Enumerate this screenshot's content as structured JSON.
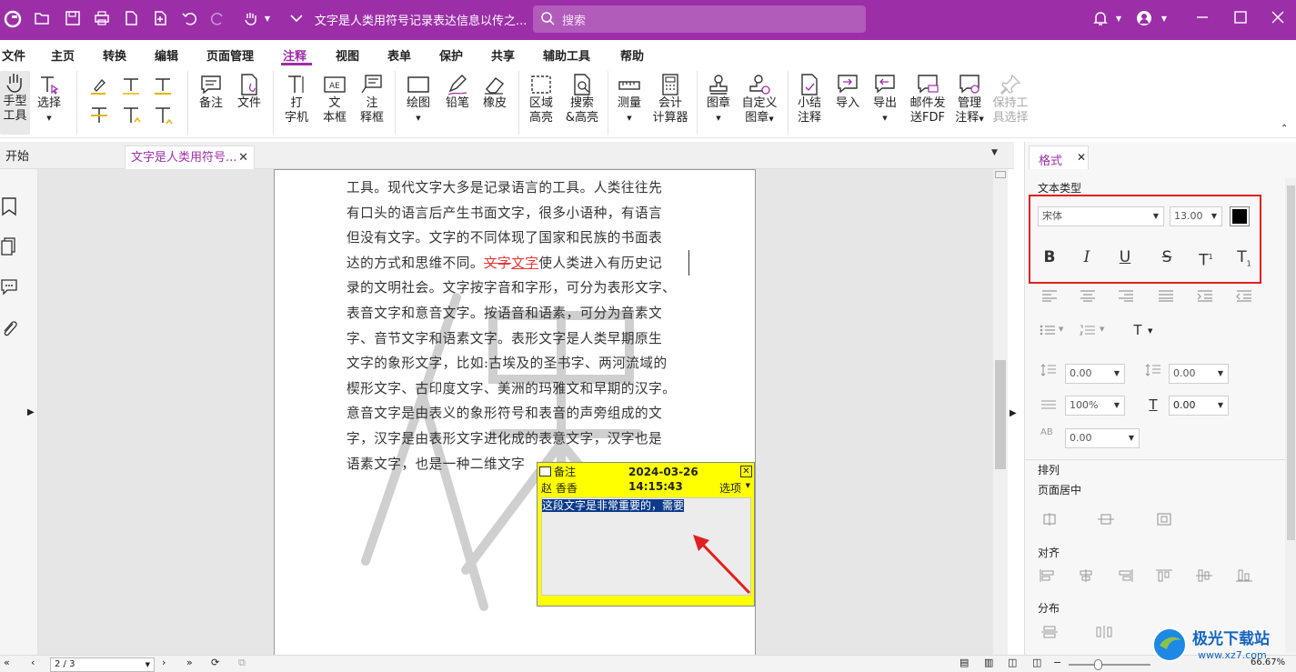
{
  "titlebar": {
    "doc_title": "文字是人类用符号记录表达信息以传之...",
    "search_placeholder": "搜索",
    "bg": "#9c2fa8"
  },
  "menu": [
    "文件",
    "主页",
    "转换",
    "编辑",
    "页面管理",
    "注释",
    "视图",
    "表单",
    "保护",
    "共享",
    "辅助工具",
    "帮助"
  ],
  "menu_active": "注释",
  "ribbon": {
    "hand_tool": "手型\n工具",
    "select": "选择",
    "note": "备注",
    "file": "文件",
    "typewriter": [
      "打",
      "字机"
    ],
    "textbox": [
      "文",
      "本框"
    ],
    "callout": [
      "注",
      "释框"
    ],
    "draw": "绘图",
    "pencil": "铅笔",
    "eraser": "橡皮",
    "area_highlight": [
      "区域",
      "高亮"
    ],
    "search_highlight": [
      "搜索",
      "&高亮"
    ],
    "measure": "测量",
    "calculator": [
      "会计",
      "计算器"
    ],
    "stamp": "图章",
    "custom_stamp": [
      "自定义",
      "图章"
    ],
    "summarize": [
      "小结",
      "注释"
    ],
    "import": "导入",
    "export": "导出",
    "email_fdf": [
      "邮件发",
      "送FDF"
    ],
    "manage": [
      "管理",
      "注释"
    ],
    "keep_tool": [
      "保持工",
      "具选择"
    ]
  },
  "tabs": {
    "start": "开始",
    "doc": "文字是人类用符号..."
  },
  "document": {
    "paragraph": [
      "工具。现代文字大多是记录语言的工具。人类往往先",
      "有口头的语言后产生书面文字，很多小语种，有语言",
      "但没有文字。文字的不同体现了国家和民族的书面表",
      "达的方式和思维不同。",
      "文字",
      "文字",
      "使人类进入有历史记",
      "录的文明社会。文字按字音和字形，可分为表形文字、",
      "表音文字和意音文字。按语音和语素，可分为音素文",
      "字、音节文字和语素文字。表形文字是人类早期原生",
      "文字的象形文字，比如:古埃及的圣书字、两河流域的",
      "楔形文字、古印度文字、美洲的玛雅文和早期的汉字。",
      "意音文字是由表义的象形符号和表音的声旁组成的文",
      "字，汉字是由表形文字进化成的表意文字，汉字也是",
      "语素文字，也是一种二维文字"
    ]
  },
  "note": {
    "label": "备注",
    "datetime": "2024-03-26 14:15:43",
    "author": "赵 香香",
    "options": "选项",
    "content": "这段文字是非常重要的，需要",
    "bg": "#ffff00"
  },
  "format_panel": {
    "tab": "格式",
    "text_type": "文本类型",
    "font": "宋体",
    "size": "13.00",
    "color": "#000000",
    "line_spacing_before": "0.00",
    "line_spacing_after": "0.00",
    "scale": "100%",
    "baseline": "0.00",
    "char_spacing": "0.00",
    "arrange": "排列",
    "page_center": "页面居中",
    "align": "对齐",
    "distribute": "分布"
  },
  "status": {
    "page": "2 / 3",
    "zoom": "66.67%"
  },
  "watermark_site": "极光下载站",
  "watermark_url": "www.xz7.com"
}
